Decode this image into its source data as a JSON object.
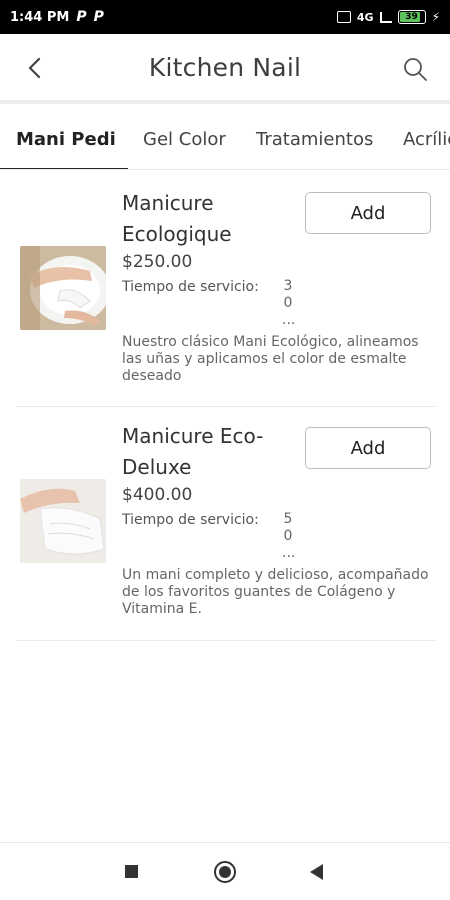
{
  "status_bar": {
    "time": "1:44 PM",
    "notif_1": "P",
    "notif_2": "P",
    "network": "4G",
    "battery": "39"
  },
  "header": {
    "title": "Kitchen Nail",
    "back_icon": "chevron-left-icon",
    "search_icon": "search-icon"
  },
  "tabs": [
    {
      "label": "Mani Pedi",
      "active": true
    },
    {
      "label": "Gel Color",
      "active": false
    },
    {
      "label": "Tratamientos",
      "active": false
    },
    {
      "label": "Acrílico",
      "active": false
    }
  ],
  "services": [
    {
      "name": "Manicure Ecologique",
      "price": "$250.00",
      "time_label": "Tiempo de servicio:",
      "time_value": [
        "3",
        "0",
        "..."
      ],
      "description": "Nuestro clásico Mani Ecológico, alineamos las uñas y aplicamos el color de esmalte deseado",
      "button": "Add"
    },
    {
      "name": "Manicure Eco-Deluxe",
      "price": "$400.00",
      "time_label": "Tiempo de servicio:",
      "time_value": [
        "5",
        "0",
        "..."
      ],
      "description": "Un mani completo y delicioso, acompañado de los favoritos guantes de Colágeno y Vitamina E.",
      "button": "Add"
    }
  ],
  "nav": {
    "recents_icon": "square-icon",
    "home_icon": "circle-icon",
    "back_icon": "triangle-back-icon"
  }
}
